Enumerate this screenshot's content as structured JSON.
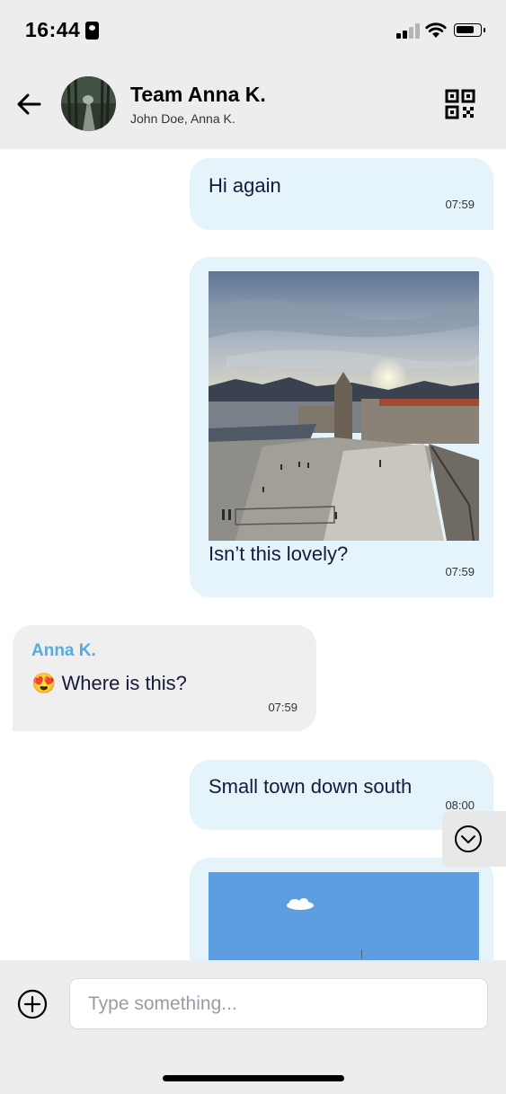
{
  "status_bar": {
    "time": "16:44"
  },
  "header": {
    "title": "Team Anna K.",
    "subtitle": "John Doe, Anna K.",
    "icons": [
      "back-arrow-icon",
      "group-avatar",
      "qr-code-icon"
    ]
  },
  "messages": [
    {
      "direction": "outgoing",
      "text": "Hi again",
      "time": "07:59"
    },
    {
      "direction": "outgoing",
      "image": "seaside-town-church-photo",
      "text": "Isn’t this lovely?",
      "time": "07:59"
    },
    {
      "direction": "incoming",
      "sender": "Anna K.",
      "emoji": "😍",
      "text": "Where is this?",
      "time": "07:59"
    },
    {
      "direction": "outgoing",
      "text": "Small town down south",
      "time": "08:00"
    },
    {
      "direction": "outgoing",
      "image": "blue-sky-photo"
    }
  ],
  "composer": {
    "placeholder": "Type something..."
  },
  "colors": {
    "bar_background": "#ededed",
    "outgoing_bubble": "#e5f4fb",
    "incoming_bubble": "#efefef",
    "sender_name": "#5aa9dc",
    "text": "#161a3a"
  }
}
